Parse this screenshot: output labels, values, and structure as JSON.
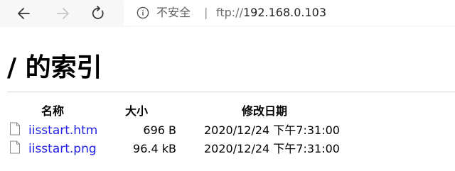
{
  "browser": {
    "back_icon": "arrow-left-icon",
    "forward_icon": "arrow-right-icon",
    "refresh_icon": "refresh-icon",
    "security_icon": "info-circle-icon",
    "security_label": "不安全",
    "separator": "|",
    "url_scheme": "ftp://",
    "url_host": "192.168.0.103"
  },
  "page": {
    "title": "/ 的索引",
    "columns": {
      "name": "名称",
      "size": "大小",
      "modified": "修改日期"
    },
    "files": [
      {
        "icon": "file-icon",
        "name": "iisstart.htm",
        "size": "696 B",
        "modified": "2020/12/24 下午7:31:00"
      },
      {
        "icon": "file-icon",
        "name": "iisstart.png",
        "size": "96.4 kB",
        "modified": "2020/12/24 下午7:31:00"
      }
    ]
  },
  "colors": {
    "link": "#1f1fe6",
    "toolbar_bg": "#f7f7f7",
    "forward_disabled": "#c8c8c8"
  }
}
